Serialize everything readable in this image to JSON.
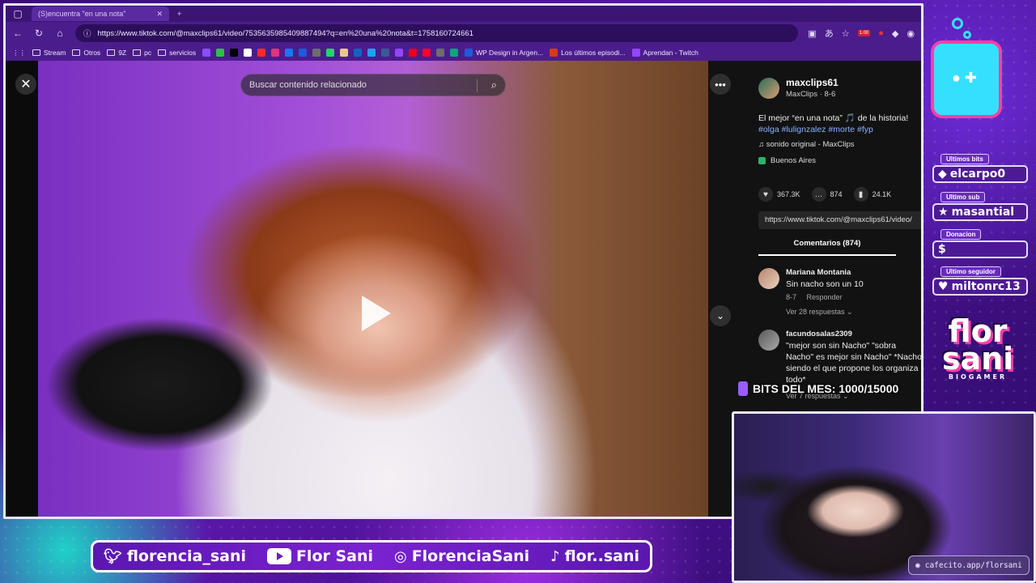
{
  "browser": {
    "tab_title": "(S)encuentra \"en una nota\"",
    "url": "https://www.tiktok.com/@maxclips61/video/7535635985409887494?q=en%20una%20nota&t=1758160724661",
    "zoom_badge": "1.00",
    "bookmarks": [
      {
        "label": "Stream",
        "type": "folder"
      },
      {
        "label": "Otros",
        "type": "folder"
      },
      {
        "label": "9Z",
        "type": "folder"
      },
      {
        "label": "pc",
        "type": "folder"
      },
      {
        "label": "servicios",
        "type": "folder"
      },
      {
        "label": "WP Design in Argen...",
        "type": "site"
      },
      {
        "label": "Los últimos episodi...",
        "type": "site"
      },
      {
        "label": "Aprendan - Twitch",
        "type": "site"
      }
    ],
    "favicon_colors": [
      "#8a4dff",
      "#2fbf4a",
      "#000000",
      "#ffffff",
      "#ff2a2a",
      "#e2337c",
      "#1877f2",
      "#1e5bd8",
      "#6d6d6d",
      "#25d366",
      "#e7c88b",
      "#0a66c2",
      "#1da1f2",
      "#3b5998",
      "#9146ff",
      "#e60023",
      "#ff0033",
      "#6d6d6d",
      "#10a37f"
    ]
  },
  "tiktok": {
    "search_placeholder": "Buscar contenido relacionado",
    "author_handle": "maxclips61",
    "author_sub": "MaxClips · 8-6",
    "description": "El mejor “en una nota” 🎵 de la historia!",
    "hashtags": "#olga #lulignzalez #morte #fyp",
    "sound": "♫  sonido original - MaxClips",
    "location": "Buenos Aires",
    "likes": "367.3K",
    "comments_count": "874",
    "saves": "24.1K",
    "copy_link": "https://www.tiktok.com/@maxclips61/video/",
    "comments_tab": "Comentarios (874)",
    "comments": [
      {
        "user": "Mariana Montania",
        "text": "Sin nacho son un 10",
        "date": "8-7",
        "reply": "Responder",
        "replies": "Ver 28 respuestas ⌄"
      },
      {
        "user": "facundosalas2309",
        "text": "\"mejor son sin Nacho\" \"sobra Nacho\" es mejor sin Nacho\" *Nacho siendo el que propone los organiza todo*",
        "replies": "Ver 7 respuestas ⌄"
      }
    ]
  },
  "overlay": {
    "bits_bar": "BITS DEL MES: 1000/15000",
    "widgets": [
      {
        "label": "Ultimos bits",
        "value": "elcarpo0",
        "icon": "◆"
      },
      {
        "label": "Ultimo sub",
        "value": "masantial",
        "icon": "★"
      },
      {
        "label": "Donacion",
        "value": "",
        "icon": "$"
      },
      {
        "label": "Ultimo seguidor",
        "value": "miltonrc13",
        "icon": "♥"
      }
    ],
    "brand_line1": "flor",
    "brand_line2": "sani",
    "brand_sub": "BIOGAMER",
    "cafecito": "cafecito.app/florsani",
    "socials": [
      {
        "icon": "twitter-icon",
        "label": "florencia_sani"
      },
      {
        "icon": "youtube-icon",
        "label": "Flor Sani"
      },
      {
        "icon": "instagram-icon",
        "label": "FlorenciaSani"
      },
      {
        "icon": "tiktok-icon",
        "label": "flor..sani"
      }
    ]
  }
}
